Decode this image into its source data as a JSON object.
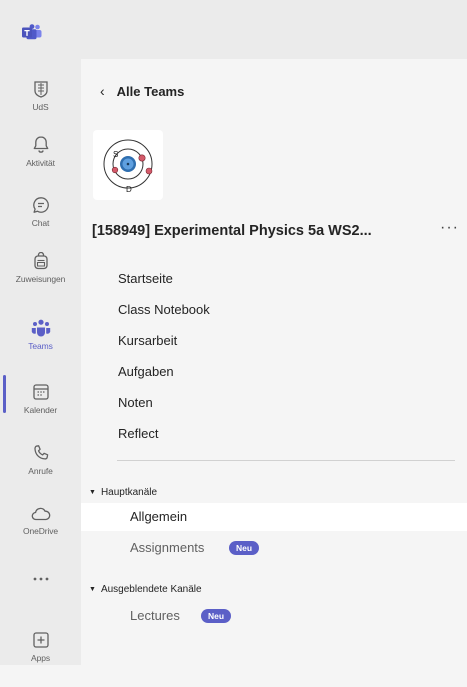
{
  "rail": {
    "items": [
      {
        "label": "UdS",
        "icon": "university-crest-icon"
      },
      {
        "label": "Aktivität",
        "icon": "bell-icon"
      },
      {
        "label": "Chat",
        "icon": "chat-icon"
      },
      {
        "label": "Zuweisungen",
        "icon": "backpack-icon"
      },
      {
        "label": "Teams",
        "icon": "teams-people-icon"
      },
      {
        "label": "Kalender",
        "icon": "calendar-icon"
      },
      {
        "label": "Anrufe",
        "icon": "phone-icon"
      },
      {
        "label": "OneDrive",
        "icon": "cloud-icon"
      },
      {
        "label": "",
        "icon": "more-dots-icon"
      },
      {
        "label": "Apps",
        "icon": "add-apps-icon"
      }
    ]
  },
  "panel": {
    "back_label": "Alle Teams",
    "team_title": "[158949] Experimental Physics 5a WS2...",
    "more_glyph": "···",
    "avatar_letters": {
      "s": "S",
      "d": "D"
    },
    "nav": [
      "Startseite",
      "Class Notebook",
      "Kursarbeit",
      "Aufgaben",
      "Noten",
      "Reflect"
    ],
    "sections": [
      {
        "title": "Hauptkanäle",
        "channels": [
          {
            "name": "Allgemein",
            "badge": ""
          },
          {
            "name": "Assignments",
            "badge": "Neu"
          }
        ]
      },
      {
        "title": "Ausgeblendete Kanäle",
        "channels": [
          {
            "name": "Lectures",
            "badge": "Neu"
          }
        ]
      }
    ]
  },
  "colors": {
    "accent": "#5b5fc7",
    "rail_bg": "#ebebeb",
    "panel_bg": "#f5f5f5",
    "selected_bg": "#ffffff"
  }
}
